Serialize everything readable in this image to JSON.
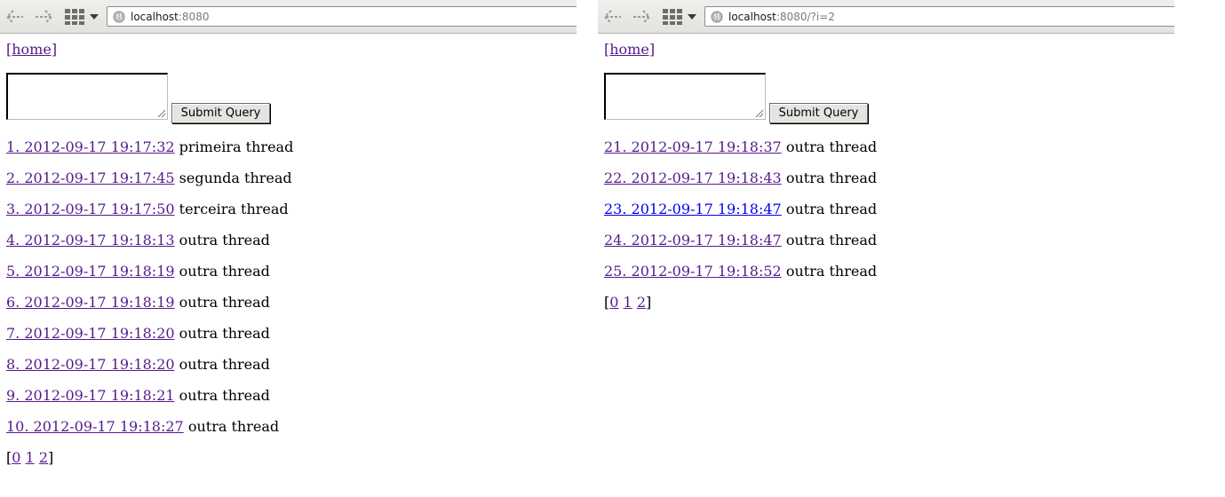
{
  "windows": [
    {
      "url_host": "localhost",
      "url_rest": ":8080",
      "home_label": "[home]",
      "submit_label": "Submit Query",
      "threads": [
        {
          "link": "1. 2012-09-17 19:17:32",
          "title": "primeira thread",
          "visited": true
        },
        {
          "link": "2. 2012-09-17 19:17:45",
          "title": "segunda thread",
          "visited": true
        },
        {
          "link": "3. 2012-09-17 19:17:50",
          "title": "terceira thread",
          "visited": true
        },
        {
          "link": "4. 2012-09-17 19:18:13",
          "title": "outra thread",
          "visited": true
        },
        {
          "link": "5. 2012-09-17 19:18:19",
          "title": "outra thread",
          "visited": true
        },
        {
          "link": "6. 2012-09-17 19:18:19",
          "title": "outra thread",
          "visited": true
        },
        {
          "link": "7. 2012-09-17 19:18:20",
          "title": "outra thread",
          "visited": true
        },
        {
          "link": "8. 2012-09-17 19:18:20",
          "title": "outra thread",
          "visited": true
        },
        {
          "link": "9. 2012-09-17 19:18:21",
          "title": "outra thread",
          "visited": true
        },
        {
          "link": "10. 2012-09-17 19:18:27",
          "title": "outra thread",
          "visited": true
        }
      ],
      "pager": {
        "open": "[",
        "close": "]",
        "pages": [
          "0",
          "1",
          "2"
        ]
      }
    },
    {
      "url_host": "localhost",
      "url_rest": ":8080/?i=2",
      "home_label": "[home]",
      "submit_label": "Submit Query",
      "threads": [
        {
          "link": "21. 2012-09-17 19:18:37",
          "title": "outra thread",
          "visited": true
        },
        {
          "link": "22. 2012-09-17 19:18:43",
          "title": "outra thread",
          "visited": true
        },
        {
          "link": "23. 2012-09-17 19:18:47",
          "title": "outra thread",
          "visited": false
        },
        {
          "link": "24. 2012-09-17 19:18:47",
          "title": "outra thread",
          "visited": true
        },
        {
          "link": "25. 2012-09-17 19:18:52",
          "title": "outra thread",
          "visited": true
        }
      ],
      "pager": {
        "open": "[",
        "close": "]",
        "pages": [
          "0",
          "1",
          "2"
        ]
      }
    }
  ]
}
